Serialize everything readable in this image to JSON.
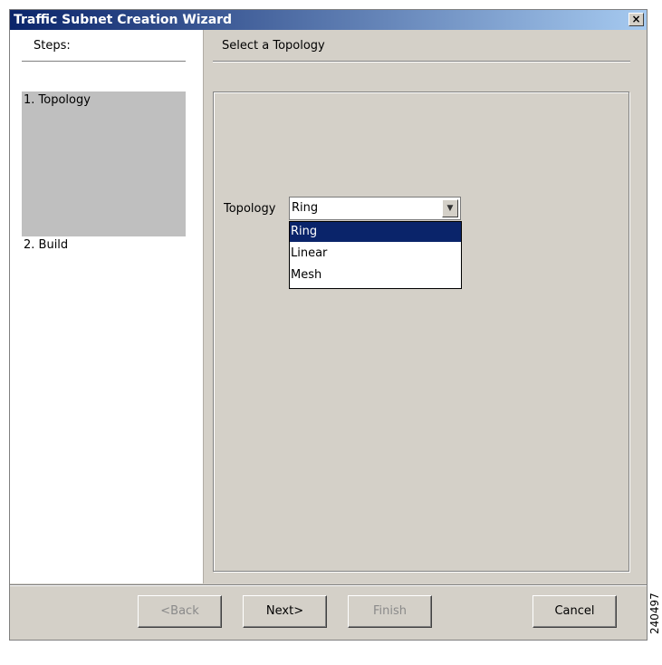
{
  "window": {
    "title": "Traffic Subnet Creation Wizard",
    "close_glyph": "×",
    "close_icon": "close-icon"
  },
  "steps": {
    "header": "Steps:",
    "items": [
      {
        "label": "1. Topology",
        "active": true
      },
      {
        "label": "2. Build",
        "active": false
      }
    ]
  },
  "panel": {
    "title": "Select a Topology",
    "topology_label": "Topology",
    "selected": "Ring",
    "dropdown_arrow_glyph": "▼",
    "options": [
      "Ring",
      "Linear",
      "Mesh"
    ],
    "highlighted_option": "Ring"
  },
  "buttons": {
    "back": "<Back",
    "next": "Next>",
    "finish": "Finish",
    "cancel": "Cancel"
  },
  "figure_number": "240497",
  "colors": {
    "titlebar_start": "#0a246a",
    "selection": "#0a246a",
    "dialog_bg": "#d4d0c8"
  }
}
